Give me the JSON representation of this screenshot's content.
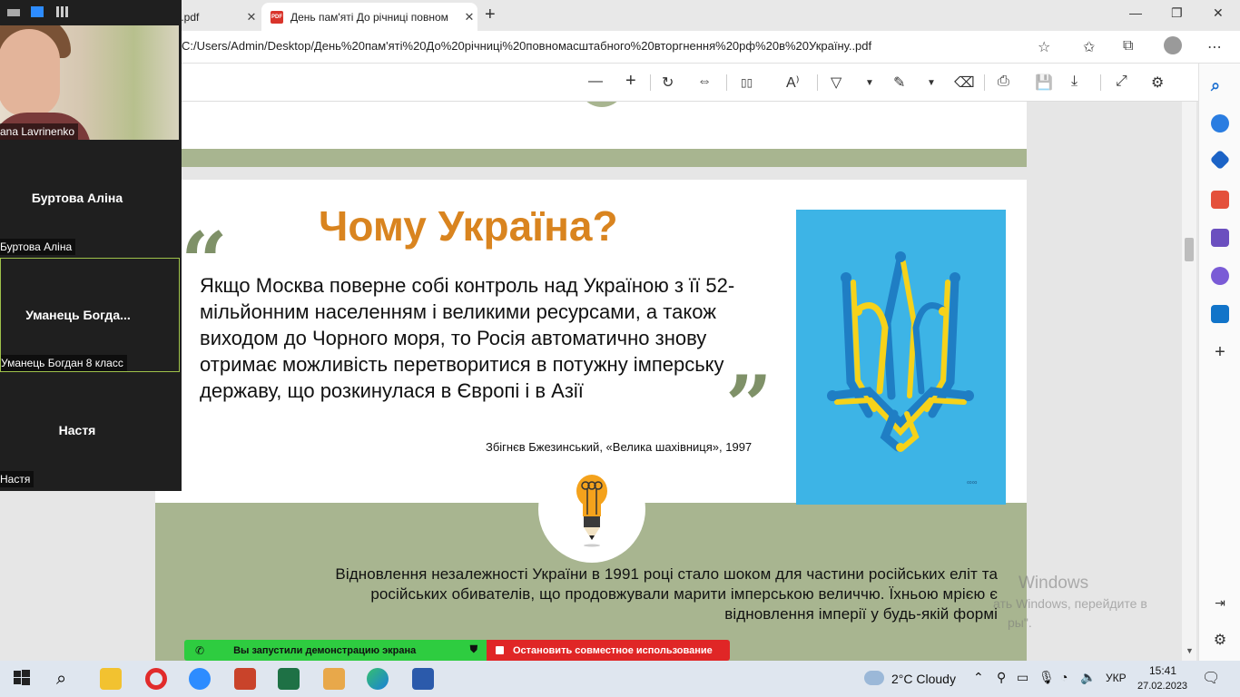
{
  "browser": {
    "tabs": [
      {
        "label": "ı.pdf"
      },
      {
        "label": "День пам'яті До річниці повном"
      }
    ],
    "new_tab": "+",
    "window_controls": {
      "minimize": "—",
      "restore": "❐",
      "close": "✕"
    },
    "url": "C:/Users/Admin/Desktop/День%20пам'яті%20До%20річниці%20повномасштабного%20вторгнення%20рф%20в%20Україну..pdf"
  },
  "pdf_toolbar": {
    "zoom_out": "—",
    "zoom_in": "+",
    "rotate": "↻",
    "fit": "⇔",
    "page_view": "▯▯",
    "read_aloud": "A⁾",
    "highlight": "▽",
    "draw": "✎",
    "erase": "⌫",
    "print": "⎙",
    "save": "💾",
    "save_as": "⤓",
    "fullscreen": "⤢",
    "settings": "⚙"
  },
  "document": {
    "heading": "Чому Україна?",
    "quote_open": "“",
    "quote_close": "”",
    "quote": "Якщо Москва поверне собі контроль над Україною з її 52-мільйонним населенням і великими ресурсами, а також виходом до Чорного моря, то Росія автоматично знову отримає можливість перетворитися в потужну імперську державу, що розкинулася в Європі і в Азії",
    "attribution": "Збігнєв Бжезинський, «Велика шахівниця», 1997",
    "poster_signature": "∞∞",
    "paragraph": "Відновлення незалежності України в 1991 році стало шоком для частини російських еліт та російських обивателів, що продовжували марити імперською величчю. Їхньою мрією є відновлення імперії у будь-якій формі"
  },
  "watermark": {
    "line1": "Windows",
    "line2": "ать Windows, перейдите в",
    "line3": "ры\"."
  },
  "zoom": {
    "participants": [
      {
        "tag": "ana Lavrinenko"
      },
      {
        "name": "Буртова Аліна",
        "tag": "Буртова Аліна"
      },
      {
        "name": "Уманець  Богда...",
        "tag": "Уманець Богдан 8 класс"
      },
      {
        "name": "Настя",
        "tag": "Настя"
      }
    ]
  },
  "sharebar": {
    "status": "Вы запустили демонстрацию экрана",
    "stop": "Остановить совместное использование"
  },
  "taskbar": {
    "weather": "2°C  Cloudy",
    "lang": "УКР",
    "time": "15:41",
    "date": "27.02.2023"
  },
  "colors": {
    "accent_orange": "#d9841f",
    "band_green": "#a8b590",
    "poster_blue": "#3db4e6",
    "trident_yellow": "#f6d21a",
    "trident_blue": "#1f7ec4"
  }
}
